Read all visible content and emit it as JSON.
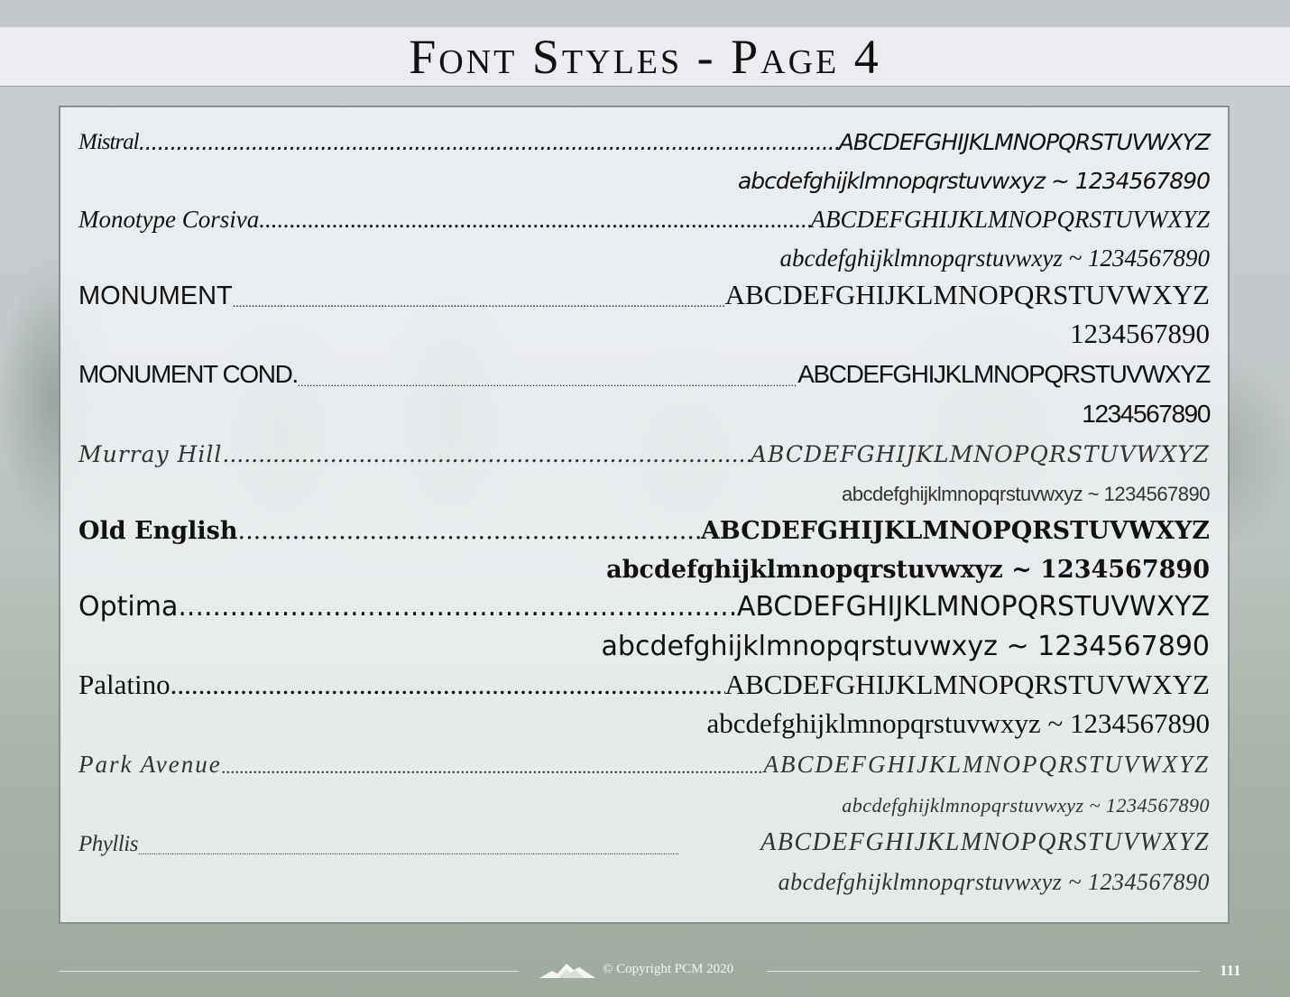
{
  "header": {
    "title": "Font Styles - Page 4"
  },
  "fonts": [
    {
      "name": "Mistral",
      "upper": "ABCDEFGHIJKLMNOPQRSTUVWXYZ",
      "lower": "abcdefghijklmnopqrstuvwxyz ~ 1234567890"
    },
    {
      "name": "Monotype Corsiva ",
      "upper": "ABCDEFGHIJKLMNOPQRSTUVWXYZ",
      "lower": "abcdefghijklmnopqrstuvwxyz ~ 1234567890"
    },
    {
      "name": "MONUMENT",
      "upper": "ABCDEFGHIJKLMNOPQRSTUVWXYZ",
      "lower": "1234567890"
    },
    {
      "name": "MONUMENT COND. ",
      "upper": "ABCDEFGHIJKLMNOPQRSTUVWXYZ",
      "lower": "1234567890"
    },
    {
      "name": "Murray Hill ",
      "upper": "ABCDEFGHIJKLMNOPQRSTUVWXYZ",
      "lower": "abcdefghijklmnopqrstuvwxyz ~ 1234567890"
    },
    {
      "name": "Old English",
      "upper": "ABCDEFGHIJKLMNOPQRSTUVWXYZ",
      "lower": "abcdefghijklmnopqrstuvwxyz ~ 1234567890"
    },
    {
      "name": "Optima",
      "upper": "ABCDEFGHIJKLMNOPQRSTUVWXYZ",
      "lower": "abcdefghijklmnopqrstuvwxyz ~ 1234567890"
    },
    {
      "name": "Palatino ",
      "upper": "ABCDEFGHIJKLMNOPQRSTUVWXYZ",
      "lower": "abcdefghijklmnopqrstuvwxyz ~ 1234567890"
    },
    {
      "name": "Park Avenue ",
      "upper": "ABCDEFGHIJKLMNOPQRSTUVWXYZ",
      "lower": "abcdefghijklmnopqrstuvwxyz ~ 1234567890"
    },
    {
      "name": "Phyllis",
      "upper": "ABCDEFGHIJKLMNOPQRSTUVWXYZ",
      "lower": "abcdefghijklmnopqrstuvwxyz ~ 1234567890"
    }
  ],
  "footer": {
    "copyright": "© Copyright PCM 2020",
    "page_number": "111",
    "logo_icon": "mountain-logo-icon"
  }
}
